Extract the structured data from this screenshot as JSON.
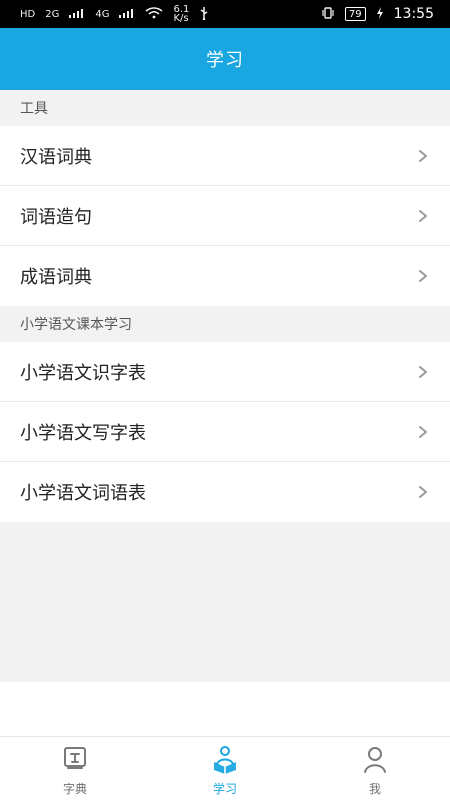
{
  "status_bar": {
    "left_items": [
      "HD",
      "2G",
      "4G"
    ],
    "network_speed": "6.1\nK/s",
    "battery": "79",
    "time": "13:55"
  },
  "app_bar": {
    "title": "学习"
  },
  "sections": [
    {
      "header": "工具",
      "items": [
        {
          "label": "汉语词典"
        },
        {
          "label": "词语造句"
        },
        {
          "label": "成语词典"
        }
      ]
    },
    {
      "header": "小学语文课本学习",
      "items": [
        {
          "label": "小学语文识字表"
        },
        {
          "label": "小学语文写字表"
        },
        {
          "label": "小学语文词语表"
        }
      ]
    }
  ],
  "bottom_nav": {
    "items": [
      {
        "label": "字典",
        "icon": "dictionary-icon",
        "active": false
      },
      {
        "label": "学习",
        "icon": "study-icon",
        "active": true
      },
      {
        "label": "我",
        "icon": "profile-icon",
        "active": false
      }
    ]
  },
  "colors": {
    "accent": "#1aa6e0"
  }
}
